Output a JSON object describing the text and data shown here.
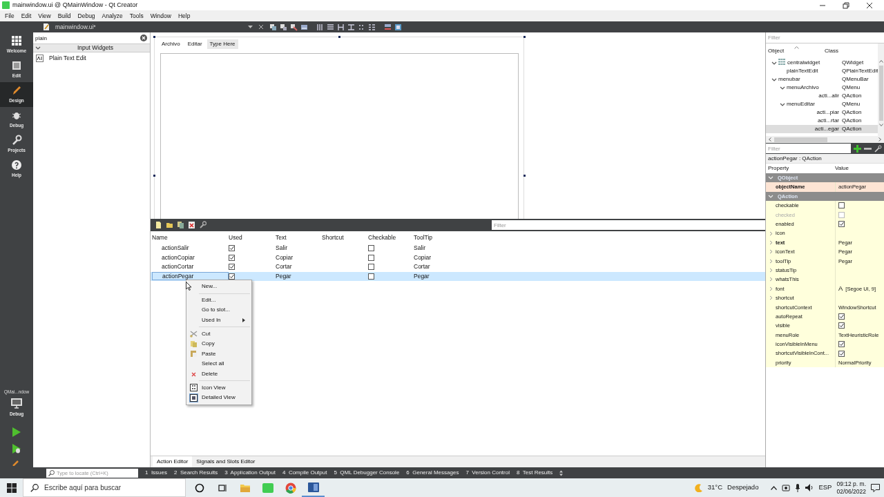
{
  "window": {
    "title": "mainwindow.ui @ QMainWindow - Qt Creator"
  },
  "menu_bar": [
    "File",
    "Edit",
    "View",
    "Build",
    "Debug",
    "Analyze",
    "Tools",
    "Window",
    "Help"
  ],
  "document_tab": {
    "title": "mainwindow.ui*"
  },
  "mode_bar": [
    {
      "label": "Welcome",
      "selected": false
    },
    {
      "label": "Edit",
      "selected": false
    },
    {
      "label": "Design",
      "selected": true
    },
    {
      "label": "Debug",
      "selected": false
    },
    {
      "label": "Projects",
      "selected": false
    },
    {
      "label": "Help",
      "selected": false
    }
  ],
  "target_selector": {
    "project": "QMai...ndow",
    "build": "Debug"
  },
  "widget_box": {
    "filter": "plain",
    "category": "Input Widgets",
    "expanded": true,
    "items": [
      "Plain Text Edit"
    ]
  },
  "form": {
    "menus": [
      {
        "kind": "menu",
        "label": "Archivo"
      },
      {
        "kind": "menu",
        "label": "Editar"
      },
      {
        "kind": "placeholder",
        "label": "Type Here"
      }
    ]
  },
  "action_editor": {
    "filter_placeholder": "Filter",
    "columns": [
      "Name",
      "Used",
      "Text",
      "Shortcut",
      "Checkable",
      "ToolTip"
    ],
    "rows": [
      {
        "name": "actionSalir",
        "used": true,
        "text": "Salir",
        "checkable": false,
        "tooltip": "Salir",
        "selected": false
      },
      {
        "name": "actionCopiar",
        "used": true,
        "text": "Copiar",
        "checkable": false,
        "tooltip": "Copiar",
        "selected": false
      },
      {
        "name": "actionCortar",
        "used": true,
        "text": "Cortar",
        "checkable": false,
        "tooltip": "Cortar",
        "selected": false
      },
      {
        "name": "actionPegar",
        "used": true,
        "text": "Pegar",
        "checkable": false,
        "tooltip": "Pegar",
        "selected": true
      }
    ]
  },
  "context_menu": {
    "items": [
      {
        "kind": "item",
        "label": "New..."
      },
      {
        "kind": "separator"
      },
      {
        "kind": "item",
        "label": "Edit..."
      },
      {
        "kind": "item",
        "label": "Go to slot..."
      },
      {
        "kind": "submenu",
        "label": "Used In"
      },
      {
        "kind": "separator"
      },
      {
        "kind": "item",
        "label": "Cut"
      },
      {
        "kind": "item",
        "label": "Copy"
      },
      {
        "kind": "item",
        "label": "Paste"
      },
      {
        "kind": "item",
        "label": "Select all"
      },
      {
        "kind": "item",
        "label": "Delete"
      },
      {
        "kind": "separator"
      },
      {
        "kind": "toggle",
        "label": "Icon View",
        "checked": false
      },
      {
        "kind": "toggle",
        "label": "Detailed View",
        "checked": true
      }
    ]
  },
  "bottom_tabs": [
    {
      "label": "Action Editor",
      "selected": true
    },
    {
      "label": "Signals and Slots Editor",
      "selected": false
    }
  ],
  "object_inspector": {
    "filter_placeholder": "Filter",
    "columns": [
      "Object",
      "Class"
    ],
    "tree": [
      {
        "object": "centralwidget",
        "class": "QWidget",
        "expanded": true,
        "selected": false,
        "children": [
          {
            "object": "plainTextEdit",
            "class": "QPlainTextEdit",
            "selected": false
          }
        ]
      },
      {
        "object": "menubar",
        "class": "QMenuBar",
        "expanded": true,
        "selected": false,
        "children": [
          {
            "object": "menuArchivo",
            "class": "QMenu",
            "expanded": true,
            "selected": false,
            "children": [
              {
                "object": "acti...alir",
                "class": "QAction",
                "selected": false
              }
            ]
          },
          {
            "object": "menuEditar",
            "class": "QMenu",
            "expanded": true,
            "selected": false,
            "children": [
              {
                "object": "acti...piar",
                "class": "QAction",
                "selected": false
              },
              {
                "object": "acti...rtar",
                "class": "QAction",
                "selected": false
              },
              {
                "object": "acti...egar",
                "class": "QAction",
                "selected": true
              }
            ]
          }
        ]
      }
    ]
  },
  "property_editor": {
    "filter_placeholder": "Filter",
    "title": "actionPegar : QAction",
    "columns": [
      "Property",
      "Value"
    ],
    "groups": [
      {
        "name": "QObject",
        "color": "#fde4d4",
        "properties": [
          {
            "name": "objectName",
            "kind": "text",
            "value": "actionPegar",
            "modified": true,
            "disabled": false
          }
        ]
      },
      {
        "name": "QAction",
        "color": "#ffffdc",
        "properties": [
          {
            "name": "checkable",
            "kind": "check",
            "checked": false,
            "modified": false,
            "disabled": false
          },
          {
            "name": "checked",
            "kind": "check",
            "checked": false,
            "modified": false,
            "disabled": true
          },
          {
            "name": "enabled",
            "kind": "check",
            "checked": true,
            "modified": false,
            "disabled": false
          },
          {
            "name": "icon",
            "kind": "text",
            "expanded": false,
            "modified": false,
            "disabled": false
          },
          {
            "name": "text",
            "kind": "text",
            "value": "Pegar",
            "expanded": false,
            "modified": true,
            "disabled": false
          },
          {
            "name": "iconText",
            "kind": "text",
            "value": "Pegar",
            "expanded": false,
            "modified": false,
            "disabled": false
          },
          {
            "name": "toolTip",
            "kind": "text",
            "value": "Pegar",
            "expanded": false,
            "modified": false,
            "disabled": false
          },
          {
            "name": "statusTip",
            "kind": "text",
            "expanded": false,
            "modified": false,
            "disabled": false
          },
          {
            "name": "whatsThis",
            "kind": "text",
            "expanded": false,
            "modified": false,
            "disabled": false
          },
          {
            "name": "font",
            "kind": "font",
            "icon_text": "A",
            "value": "[Segoe UI, 9]",
            "expanded": false,
            "modified": false,
            "disabled": false
          },
          {
            "name": "shortcut",
            "kind": "text",
            "expanded": false,
            "modified": false,
            "disabled": false
          },
          {
            "name": "shortcutContext",
            "kind": "text",
            "value": "WindowShortcut",
            "modified": false,
            "disabled": false
          },
          {
            "name": "autoRepeat",
            "kind": "check",
            "checked": true,
            "modified": false,
            "disabled": false
          },
          {
            "name": "visible",
            "kind": "check",
            "checked": true,
            "modified": false,
            "disabled": false
          },
          {
            "name": "menuRole",
            "kind": "text",
            "value": "TextHeuristicRole",
            "modified": false,
            "disabled": false
          },
          {
            "name": "iconVisibleInMenu",
            "kind": "check",
            "checked": true,
            "modified": false,
            "disabled": false
          },
          {
            "name": "shortcutVisibleInCont...",
            "kind": "check",
            "checked": true,
            "modified": false,
            "disabled": false
          },
          {
            "name": "priority",
            "kind": "text",
            "value": "NormalPriority",
            "modified": false,
            "disabled": false
          }
        ]
      }
    ]
  },
  "output_bar": {
    "locator_placeholder": "Type to locate (Ctrl+K)",
    "panes": [
      {
        "number": "1",
        "label": "Issues"
      },
      {
        "number": "2",
        "label": "Search Results"
      },
      {
        "number": "3",
        "label": "Application Output"
      },
      {
        "number": "4",
        "label": "Compile Output"
      },
      {
        "number": "5",
        "label": "QML Debugger Console"
      },
      {
        "number": "6",
        "label": "General Messages"
      },
      {
        "number": "7",
        "label": "Version Control"
      },
      {
        "number": "8",
        "label": "Test Results"
      }
    ]
  },
  "taskbar": {
    "search_placeholder": "Escribe aquí para buscar",
    "apps": [
      {
        "selected": false
      },
      {
        "selected": false
      },
      {
        "selected": false
      },
      {
        "selected": false
      },
      {
        "selected": false
      },
      {
        "selected": true
      }
    ],
    "temperature": "31°C",
    "weather": "Despejado",
    "language": "ESP",
    "time": "09:12 p. m.",
    "date": "02/06/2022"
  }
}
